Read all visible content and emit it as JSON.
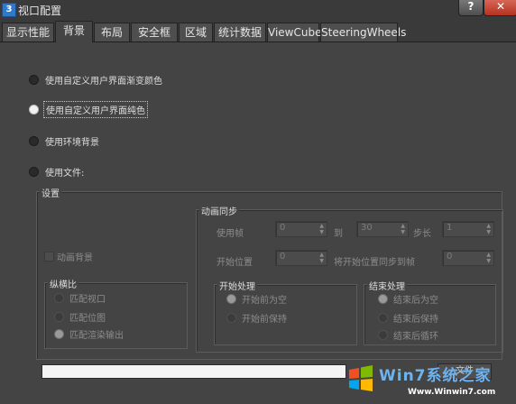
{
  "window": {
    "app_icon": "3",
    "title": "视口配置",
    "help_label": "?",
    "close_label": "✕"
  },
  "tabs": [
    {
      "label": "显示性能",
      "active": false
    },
    {
      "label": "背景",
      "active": true
    },
    {
      "label": "布局",
      "active": false
    },
    {
      "label": "安全框",
      "active": false
    },
    {
      "label": "区域",
      "active": false
    },
    {
      "label": "统计数据",
      "active": false
    },
    {
      "label": "ViewCube",
      "active": false
    },
    {
      "label": "SteeringWheels",
      "active": false
    }
  ],
  "background_options": [
    {
      "label": "使用自定义用户界面渐变颜色",
      "selected": false
    },
    {
      "label": "使用自定义用户界面纯色",
      "selected": true
    },
    {
      "label": "使用环境背景",
      "selected": false
    },
    {
      "label": "使用文件:",
      "selected": false
    }
  ],
  "settings": {
    "title": "设置",
    "animate_background_label": "动画背景",
    "aspect_ratio": {
      "title": "纵横比",
      "options": [
        {
          "label": "匹配视口",
          "selected": false
        },
        {
          "label": "匹配位图",
          "selected": false
        },
        {
          "label": "匹配渲染输出",
          "selected": true
        }
      ]
    },
    "animation_sync": {
      "title": "动画同步",
      "use_frame_label": "使用帧",
      "use_frame_value": "0",
      "to_label": "到",
      "to_value": "30",
      "step_label": "步长",
      "step_value": "1",
      "start_at_label": "开始位置",
      "start_at_value": "0",
      "sync_start_label": "将开始位置同步到帧",
      "sync_start_value": "0",
      "start_processing": {
        "title": "开始处理",
        "options": [
          {
            "label": "开始前为空",
            "selected": true
          },
          {
            "label": "开始前保持",
            "selected": false
          }
        ]
      },
      "end_processing": {
        "title": "结束处理",
        "options": [
          {
            "label": "结束后为空",
            "selected": true
          },
          {
            "label": "结束后保持",
            "selected": false
          },
          {
            "label": "结束后循环",
            "selected": false
          }
        ]
      }
    }
  },
  "file_path_value": "",
  "bottom_button_label": "文件",
  "watermark": {
    "brand": "Win7系统之家",
    "url": "Www.Winwin7.com"
  }
}
